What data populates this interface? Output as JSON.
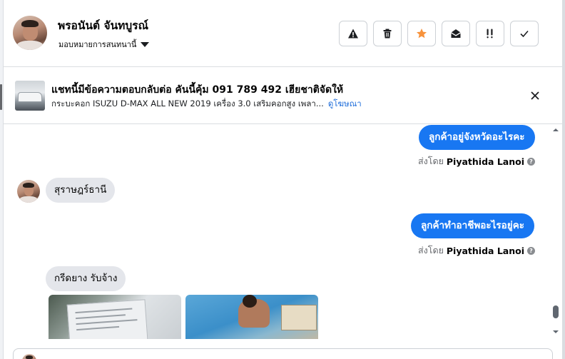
{
  "header": {
    "contact_name": "พรอนันต์ จันทบูรณ์",
    "assign_label": "มอบหมายการสนทนานี้",
    "actions": [
      {
        "name": "report-spam-button",
        "icon": "warning-icon"
      },
      {
        "name": "delete-button",
        "icon": "trash-icon"
      },
      {
        "name": "star-button",
        "icon": "star-icon"
      },
      {
        "name": "mark-unread-button",
        "icon": "envelope-open-icon"
      },
      {
        "name": "mark-important-button",
        "icon": "exclamation-icon"
      },
      {
        "name": "mark-done-button",
        "icon": "check-icon"
      }
    ]
  },
  "ad": {
    "title": "แชทนี้มีข้อความตอบกลับต่อ คันนี้คุ้ม 091 789 492 เฮียชาติจัดให้",
    "subtitle": "กระบะคอก ISUZU D-MAX ALL NEW 2019 เครื่อง 3.0 เสริมคอกสูง เพลา...",
    "link": "ดูโฆษณา"
  },
  "messages": {
    "out1": "ลูกค้าอยู่จังหวัดอะไรคะ",
    "sent_prefix": "ส่งโดย",
    "sender": "Piyathida Lanoi",
    "in1": "สุราษฎร์ธานี",
    "out2": "ลูกค้าทำอาชีพอะไรอยู่คะ",
    "in2": "กรีดยาง รับจ้าง"
  },
  "colors": {
    "accent": "#1877f2",
    "star": "#f7923b",
    "link": "#216fdb",
    "incoming_bubble": "#e4e6eb"
  }
}
